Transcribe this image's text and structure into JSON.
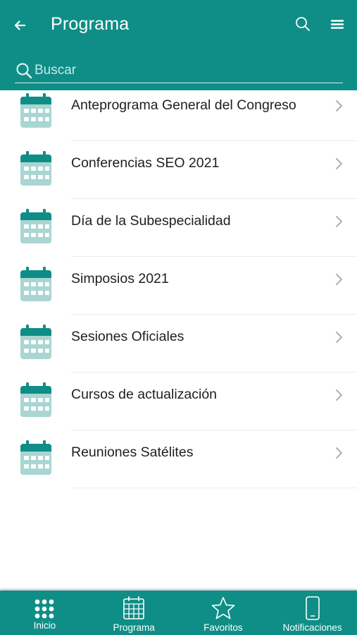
{
  "header": {
    "title": "Programa",
    "search_placeholder": "Buscar"
  },
  "items": [
    {
      "label": "Anteprograma General del Congreso"
    },
    {
      "label": "Conferencias SEO 2021"
    },
    {
      "label": "Día de la Subespecialidad"
    },
    {
      "label": "Simposios 2021"
    },
    {
      "label": "Sesiones Oficiales"
    },
    {
      "label": "Cursos de actualización"
    },
    {
      "label": "Reuniones Satélites"
    }
  ],
  "bottom_nav": {
    "items": [
      {
        "label": "Inicio",
        "icon": "grid-icon"
      },
      {
        "label": "Programa",
        "icon": "calendar-icon"
      },
      {
        "label": "Favoritos",
        "icon": "star-icon"
      },
      {
        "label": "Notificaciones",
        "icon": "phone-icon"
      }
    ]
  },
  "colors": {
    "primary": "#0e8e87",
    "calendar_header": "#0e8e87",
    "calendar_body": "#a9d6d2"
  }
}
